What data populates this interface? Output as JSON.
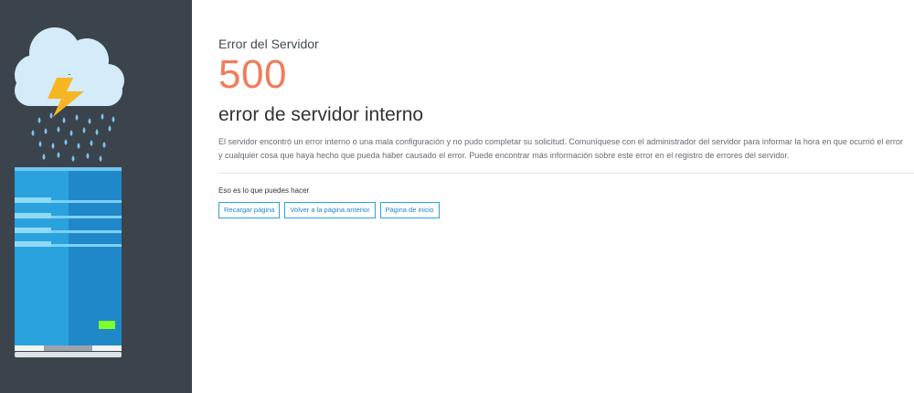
{
  "page": {
    "eyebrow": "Error del Servidor",
    "code": "500",
    "headline": "error de servidor interno",
    "description": "El servidor encontró un error interno o una mala configuración y no pudo completar su solicitud. Comuníquese con el administrador del servidor para informar la hora en que ocurrió el error y cualquier cosa que haya hecho que pueda haber causado el error. Puede encontrar más información sobre este error en el registro de errores del servidor.",
    "actions_title": "Eso es lo que puedes hacer"
  },
  "actions": [
    {
      "label": "Recargar página"
    },
    {
      "label": "Volver a la página anterior"
    },
    {
      "label": "Página de inicio"
    }
  ],
  "illustration": {
    "icons": [
      "cloud-icon",
      "lightning-icon",
      "rain-icon",
      "server-icon",
      "status-led-icon"
    ],
    "colors": {
      "sidebar": "#3b434c",
      "cloud": "#cfe8f8",
      "lightning": "#f6b623",
      "rain": "#7ec3ef",
      "server": "#2aa2dd",
      "server_shade": "#1f88c8",
      "led": "#7dff2a"
    }
  },
  "colors": {
    "accent": "#ef7c5a",
    "link": "#2ba3dc"
  }
}
